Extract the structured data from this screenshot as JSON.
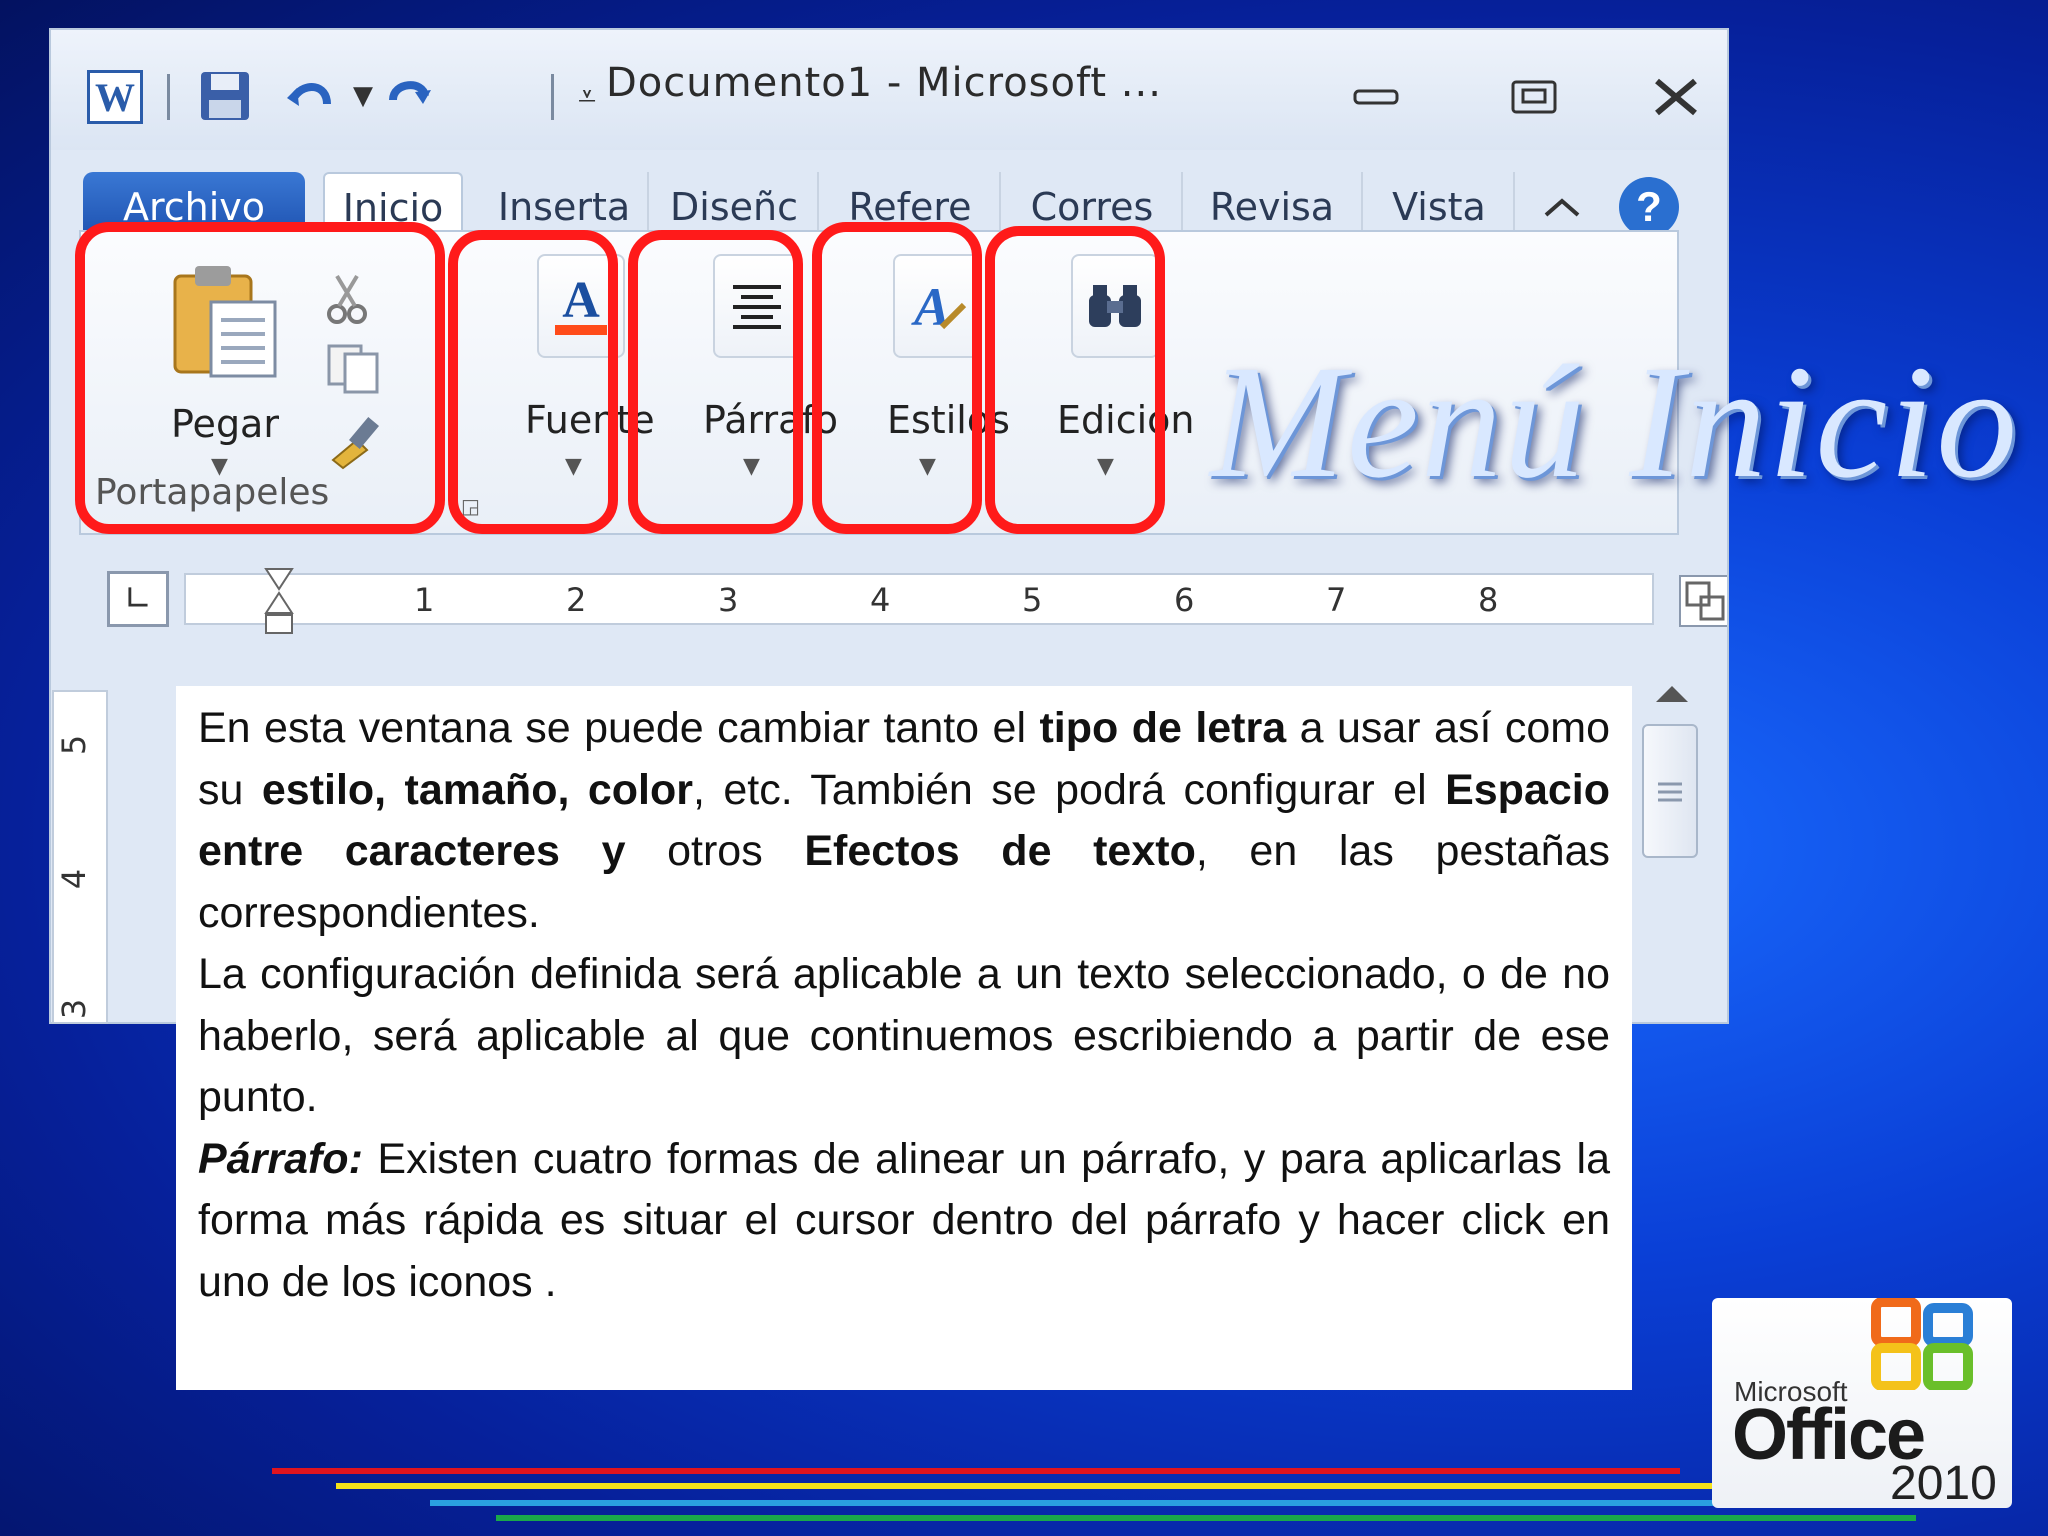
{
  "window": {
    "title": "Documento1 - Microsoft ...",
    "app_icon_letter": "W"
  },
  "tabs": [
    "Archivo",
    "Inicio",
    "Inserta",
    "Diseñc",
    "Refere",
    "Corres",
    "Revisa",
    "Vista"
  ],
  "ribbon": {
    "clipboard": {
      "paste_label": "Pegar",
      "group_label": "Portapapeles"
    },
    "groups": [
      "Fuente",
      "Párrafo",
      "Estilos",
      "Edición"
    ]
  },
  "ruler": {
    "numbers": [
      "1",
      "2",
      "3",
      "4",
      "5",
      "6",
      "7",
      "8"
    ]
  },
  "vruler": {
    "numbers": [
      "5",
      "4",
      "3"
    ]
  },
  "heading": "Menú Inicio",
  "body": {
    "p1_a": "En esta ventana se puede cambiar tanto el ",
    "p1_b": "tipo de letra",
    "p1_c": " a usar así como su ",
    "p1_d": "estilo, tamaño, color",
    "p1_e": ", etc. También se podrá configurar el ",
    "p1_f": "Espacio entre caracteres y",
    "p1_g": " otros ",
    "p1_h": "Efectos de texto",
    "p1_i": ", en las pestañas correspondientes.",
    "p2": "La configuración definida será aplicable a un texto seleccionado, o de no haberlo, será aplicable al que continuemos escribiendo a partir de ese punto.",
    "p3_a": "Párrafo:",
    "p3_b": " Existen cuatro formas de alinear un párrafo, y para aplicarlas la forma más rápida es situar el cursor dentro del párrafo y hacer click en uno de los iconos ."
  },
  "office_logo": {
    "brand": "Microsoft",
    "product": "Office",
    "year": "2010"
  },
  "colors": {
    "highlight": "#ff1a1a",
    "archivo_tab": "#1c4fae",
    "line_red": "#e0141e",
    "line_yellow": "#f4e21a",
    "line_blue": "#2aa0e0",
    "line_green": "#1aa84a"
  }
}
